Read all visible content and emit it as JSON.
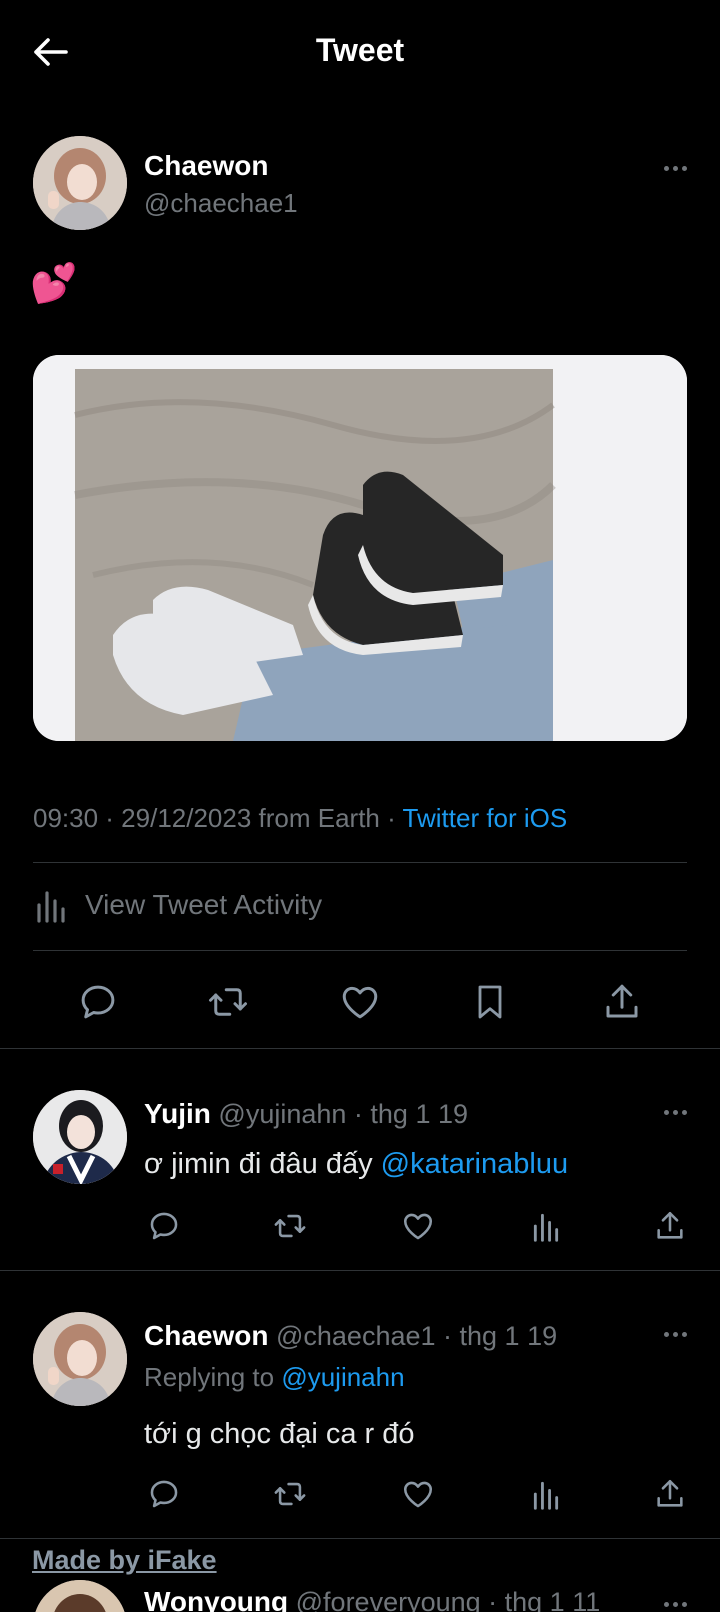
{
  "header": {
    "title": "Tweet"
  },
  "tweet": {
    "name": "Chaewon",
    "handle": "@chaechae1",
    "text": "💕",
    "time": "09:30 · 29/12/2023 from Earth · ",
    "source": "Twitter for iOS",
    "activity_label": "View Tweet Activity"
  },
  "replies": [
    {
      "name": "Yujin",
      "handle": "@yujinahn",
      "time": " · thg 1 19",
      "text": "ơ jimin đi đâu đấy ",
      "mention": "@katarinabluu"
    },
    {
      "name": "Chaewon",
      "handle": "@chaechae1",
      "time": " · thg 1 19",
      "replying_prefix": "Replying to ",
      "replying_to": "@yujinahn",
      "text": "tới g chọc đại ca r đó"
    },
    {
      "name": "Wonyoung",
      "handle": "@foreveryoung",
      "time": " · thg 1 11"
    }
  ],
  "watermark": "Made by iFake",
  "colors": {
    "background": "#000000",
    "text": "#e7e9ea",
    "muted": "#71767b",
    "link": "#1d9bf0",
    "divider": "#2f3336"
  },
  "icons": [
    "back-arrow-icon",
    "more-icon",
    "reply-icon",
    "retweet-icon",
    "like-icon",
    "bookmark-icon",
    "share-icon",
    "analytics-icon"
  ]
}
